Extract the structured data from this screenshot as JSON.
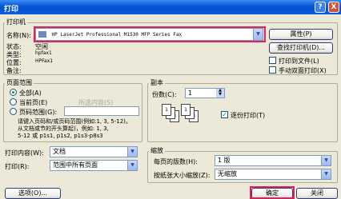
{
  "window": {
    "title": "打印",
    "help": "?",
    "close": "X"
  },
  "printer": {
    "group_label": "打印机",
    "name_label": "名称(N):",
    "name_value": "HP LaserJet Professional M1530 MFP Series Fax",
    "status_label": "状态:",
    "status_value": "空闲",
    "type_label": "类型:",
    "type_value": "hpfax1",
    "where_label": "位置:",
    "where_value": "HPFax1",
    "comment_label": "备注:",
    "comment_value": "",
    "properties_button": "属性(P)",
    "find_button": "查找打印机(D)...",
    "print_to_file": "打印到文件(L)",
    "manual_duplex": "手动双面打印(X)"
  },
  "page_range": {
    "group_label": "页面范围",
    "all": "全部(A)",
    "current": "当前页(E)",
    "selection": "所选内容(S)",
    "pages": "页码范围(G):",
    "hint": "请键入页码和/或页码范围(例如:1, 3, 5-12)。",
    "hint_2": "从文档或节的开头算起)，例如: 1, 3,",
    "hint_3": "5-12 或 p1s1, p1s2, p1s3-p8s3"
  },
  "copies": {
    "group_label": "副本",
    "count_label": "份数(C):",
    "count_value": "1",
    "collate": "逐份打印(T)",
    "page_icons": [
      "1",
      "2",
      "3"
    ]
  },
  "print_what": {
    "label": "打印内容(W):",
    "value": "文档"
  },
  "print": {
    "label": "打印(R):",
    "value": "范围中所有页面"
  },
  "zoom": {
    "group_label": "缩放",
    "pages_per_sheet_label": "每页的版数(H):",
    "pages_per_sheet_value": "1 版",
    "scale_label": "按纸张大小缩放(Z):",
    "scale_value": "无缩放"
  },
  "footer": {
    "options": "选项(O)...",
    "ok": "确定",
    "cancel": "关闭"
  }
}
